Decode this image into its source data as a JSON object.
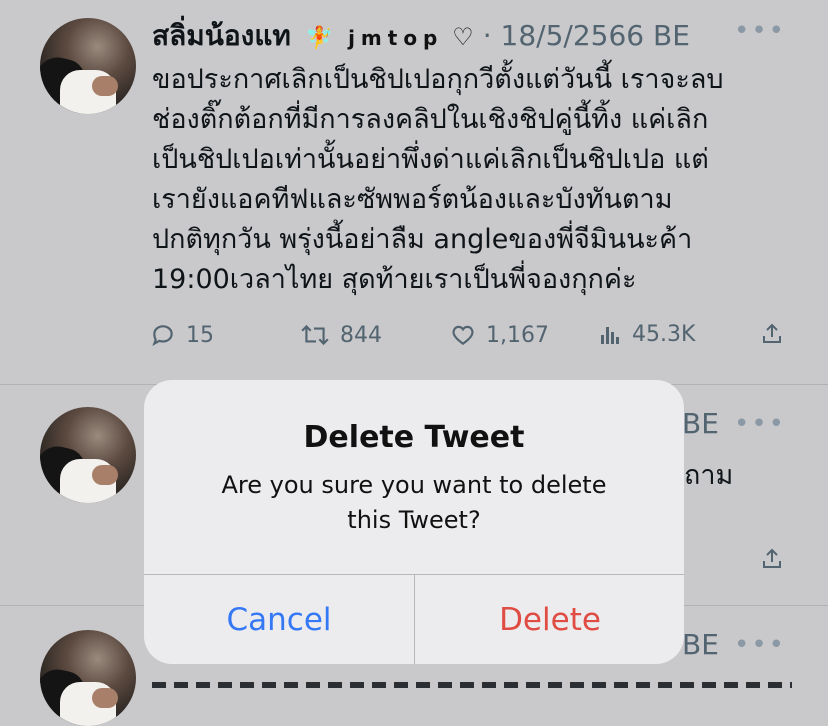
{
  "tweets": [
    {
      "author_name": "สลิ่มน้องแท",
      "emoji": "🧚",
      "handle": "jmtop",
      "heart": "♡",
      "dot": "·",
      "date": "18/5/2566 BE",
      "more": "•••",
      "lines": [
        "ขอประกาศเลิกเป็นชิปเปอกุกวีตั้งแต่วันนี้ เราจะลบ",
        "ช่องติ๊กต้อกที่มีการลงคลิปในเชิงชิปคู่นี้ทิ้ง แค่เลิก",
        "เป็นชิปเปอเท่านั้นอย่าพึ่งด่าแค่เลิกเป็นชิปเปอ แต่",
        "เรายังแอคทีฟและซัพพอร์ตน้องและบังทันตาม",
        "ปกติทุกวัน พรุ่งนี้อย่าลืม angleของพี่จีมินนะค้า",
        "19:00เวลาไทย สุดท้ายเราเป็นพี่จองกุกค่ะ"
      ],
      "replies": "15",
      "retweets": "844",
      "likes": "1,167",
      "views": "45.3K"
    },
    {
      "date_partial": "BE",
      "more": "•••",
      "text_partial": "ถาม"
    },
    {
      "date_partial": "BE",
      "more": "•••"
    }
  ],
  "dialog": {
    "title": "Delete Tweet",
    "message_line1": "Are you sure you want to delete",
    "message_line2": "this Tweet?",
    "cancel_label": "Cancel",
    "delete_label": "Delete"
  },
  "colors": {
    "cancel": "#3478f6",
    "delete": "#e04c43",
    "dim_background": "#c9c9cb",
    "dialog_background": "#ececee"
  }
}
